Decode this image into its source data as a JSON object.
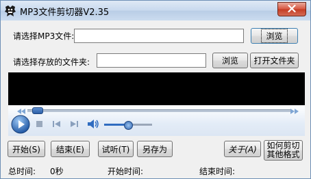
{
  "window": {
    "title": "MP3文件剪切器V2.35"
  },
  "icons": {
    "app": "app-icon",
    "close": "close-icon"
  },
  "file_row": {
    "label": "请选择MP3文件:",
    "value": "",
    "browse_label": "浏览"
  },
  "folder_row": {
    "label": "请选择存放的文件夹:",
    "value": "",
    "browse_label": "浏览",
    "open_label": "打开文件夹"
  },
  "player": {
    "seek_position": 0.02,
    "volume": 0.5
  },
  "buttons": {
    "start": "开始(S)",
    "end": "结束(E)",
    "preview": "试听(T)",
    "save_as": "另存为",
    "about": "关于(A)",
    "howto_line1": "如何剪切",
    "howto_line2": "其他格式"
  },
  "status": {
    "total_label": "总时间:",
    "total_value": "0秒",
    "start_label": "开始时间:",
    "start_value": "",
    "end_label": "结束时间:",
    "end_value": ""
  },
  "colors": {
    "title_bar": "#c8d9ee",
    "close_button": "#c43b23",
    "video_area": "#000000",
    "accent_blue": "#2f6cc0"
  }
}
